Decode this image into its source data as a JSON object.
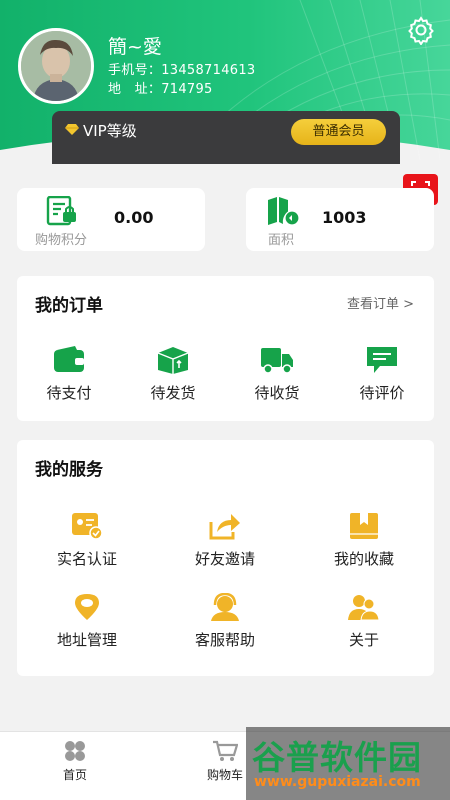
{
  "profile": {
    "username": "簡~愛",
    "phone_label": "手机号：",
    "phone": "13458714613",
    "address_label": "地　址：",
    "address": "714795"
  },
  "vip": {
    "label": "VIP等级",
    "level": "普通会员"
  },
  "stats": [
    {
      "label": "购物积分",
      "value": "0.00",
      "icon": "points-card-icon"
    },
    {
      "label": "面积",
      "value": "1003",
      "icon": "area-map-icon"
    }
  ],
  "orders": {
    "title": "我的订单",
    "view_all": "查看订单 >",
    "items": [
      {
        "label": "待支付",
        "icon": "wallet-icon"
      },
      {
        "label": "待发货",
        "icon": "package-icon"
      },
      {
        "label": "待收货",
        "icon": "truck-icon"
      },
      {
        "label": "待评价",
        "icon": "comment-icon"
      }
    ]
  },
  "services": {
    "title": "我的服务",
    "items": [
      {
        "label": "实名认证",
        "icon": "id-card-icon"
      },
      {
        "label": "好友邀请",
        "icon": "share-icon"
      },
      {
        "label": "我的收藏",
        "icon": "bookmark-icon"
      },
      {
        "label": "地址管理",
        "icon": "location-pin-icon"
      },
      {
        "label": "客服帮助",
        "icon": "customer-service-icon"
      },
      {
        "label": "关于",
        "icon": "users-icon"
      }
    ]
  },
  "nav": [
    {
      "label": "首页",
      "icon": "home-icon"
    },
    {
      "label": "购物车",
      "icon": "cart-icon"
    }
  ],
  "watermark": {
    "brand": "谷普软件园",
    "url": "www.gupuxiazai.com"
  },
  "colors": {
    "brand_green": "#1fc47a",
    "vip_dark": "#3b3b3d",
    "vip_gold": "#f2c52e",
    "scan_red": "#e8141a",
    "icon_green": "#16a34a",
    "icon_gold": "#f0b428"
  }
}
